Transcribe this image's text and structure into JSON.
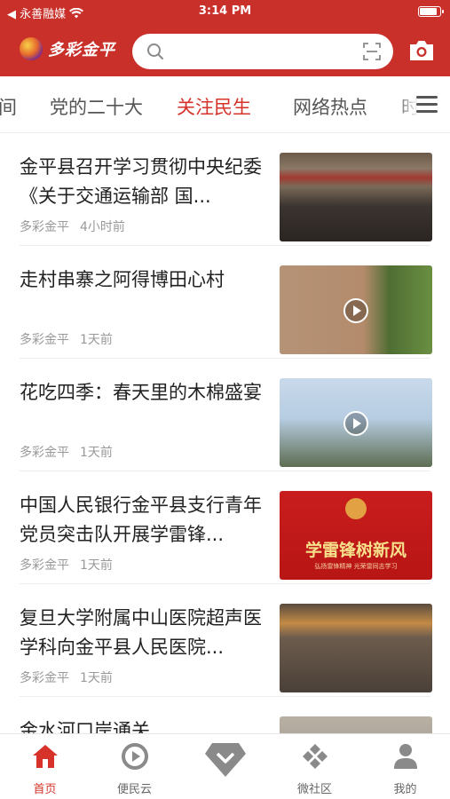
{
  "status_bar": {
    "back_app": "◀ 永善融媒",
    "time": "3:14 PM"
  },
  "header": {
    "logo_text": "多彩金平",
    "search_placeholder": ""
  },
  "tabs": [
    {
      "label": "间",
      "active": false
    },
    {
      "label": "党的二十大",
      "active": false
    },
    {
      "label": "关注民生",
      "active": true
    },
    {
      "label": "网络热点",
      "active": false
    },
    {
      "label": "时",
      "active": false
    }
  ],
  "news": [
    {
      "title": "金平县召开学习贯彻中央纪委《关于交通运输部 国...",
      "source": "多彩金平",
      "time": "4小时前",
      "video": false
    },
    {
      "title": "走村串寨之阿得博田心村",
      "source": "多彩金平",
      "time": "1天前",
      "video": true
    },
    {
      "title": "花吃四季：春天里的木棉盛宴",
      "source": "多彩金平",
      "time": "1天前",
      "video": true
    },
    {
      "title": "中国人民银行金平县支行青年党员突击队开展学雷锋...",
      "source": "多彩金平",
      "time": "1天前",
      "video": false,
      "poster_title": "学雷锋树新风",
      "poster_sub": "弘扬雷锋精神 光荣雷同志学习"
    },
    {
      "title": "复旦大学附属中山医院超声医学科向金平县人民医院...",
      "source": "多彩金平",
      "time": "1天前",
      "video": false
    },
    {
      "title": "金水河口岸通关",
      "source": "",
      "time": "",
      "video": false
    }
  ],
  "bottom_nav": [
    {
      "label": "首页",
      "icon": "home-icon",
      "active": true
    },
    {
      "label": "便民云",
      "icon": "cloud-service-icon",
      "active": false
    },
    {
      "label": "",
      "icon": "center-diamond-icon",
      "active": false
    },
    {
      "label": "微社区",
      "icon": "community-icon",
      "active": false
    },
    {
      "label": "我的",
      "icon": "profile-icon",
      "active": false
    }
  ],
  "colors": {
    "brand_red": "#c9302a",
    "active_red": "#d6322a",
    "text_dark": "#222222",
    "text_meta": "#999999"
  }
}
